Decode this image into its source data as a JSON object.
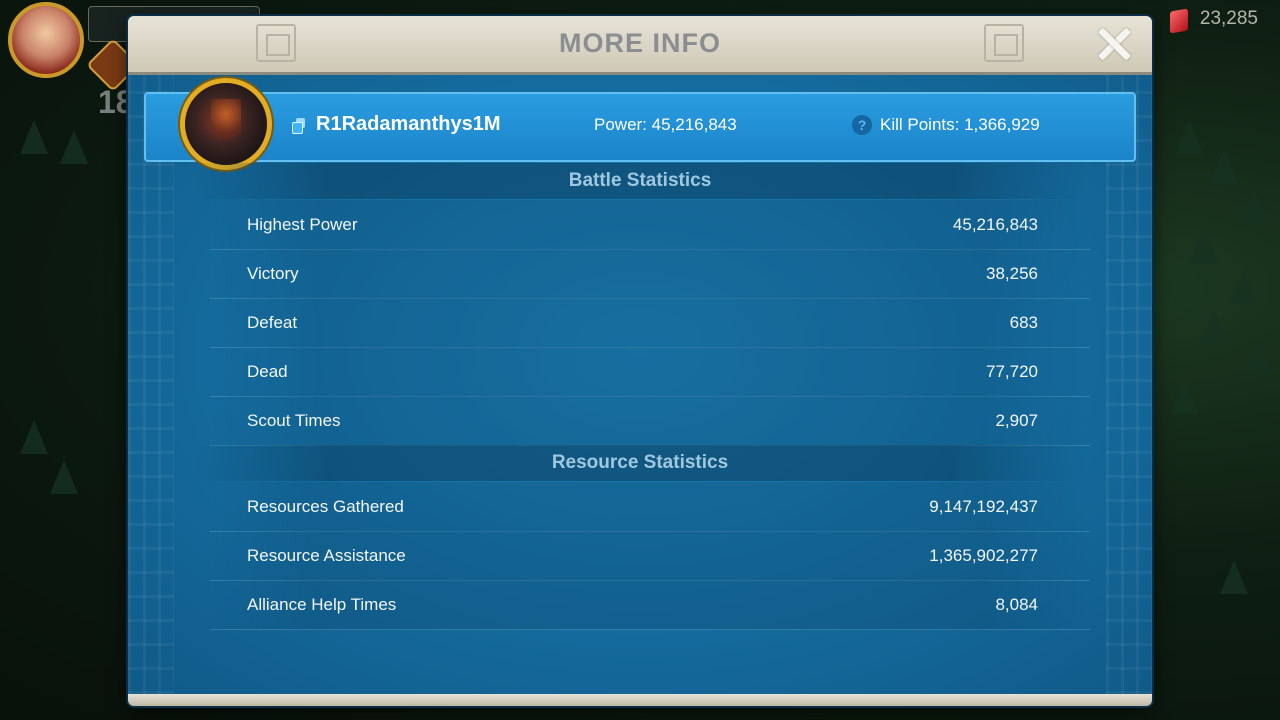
{
  "window": {
    "title": "MORE INFO"
  },
  "hud": {
    "gems": "23,285",
    "level_hint": "18"
  },
  "player": {
    "name": "R1Radamanthys1M",
    "power": "Power: 45,216,843",
    "kill_points": "Kill Points: 1,366,929",
    "help_glyph": "?"
  },
  "battle": {
    "header": "Battle Statistics",
    "rows": [
      {
        "label": "Highest Power",
        "value": "45,216,843"
      },
      {
        "label": "Victory",
        "value": "38,256"
      },
      {
        "label": "Defeat",
        "value": "683"
      },
      {
        "label": "Dead",
        "value": "77,720"
      },
      {
        "label": "Scout Times",
        "value": "2,907"
      }
    ]
  },
  "resource": {
    "header": "Resource Statistics",
    "rows": [
      {
        "label": "Resources Gathered",
        "value": "9,147,192,437"
      },
      {
        "label": "Resource Assistance",
        "value": "1,365,902,277"
      },
      {
        "label": "Alliance Help Times",
        "value": "8,084"
      }
    ]
  },
  "icons": {
    "close": "close-icon",
    "copy": "copy-icon",
    "help": "help-icon",
    "gem": "gem-icon"
  }
}
